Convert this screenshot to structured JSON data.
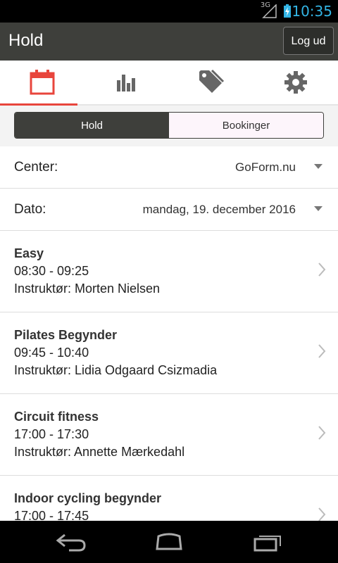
{
  "status": {
    "network": "3G",
    "time": "10:35"
  },
  "appbar": {
    "title": "Hold",
    "logout_label": "Log ud"
  },
  "tabs": [
    {
      "icon": "calendar-icon",
      "active": true
    },
    {
      "icon": "bar-chart-icon",
      "active": false
    },
    {
      "icon": "tag-icon",
      "active": false
    },
    {
      "icon": "gear-icon",
      "active": false
    }
  ],
  "segment": {
    "left": "Hold",
    "right": "Bookinger",
    "selected": "Hold"
  },
  "filters": {
    "center": {
      "label": "Center:",
      "value": "GoForm.nu"
    },
    "date": {
      "label": "Dato:",
      "value": "mandag, 19. december 2016"
    }
  },
  "classes": [
    {
      "name": "Easy",
      "time": "08:30 - 09:25",
      "instructor": "Instruktør: Morten Nielsen"
    },
    {
      "name": "Pilates Begynder",
      "time": "09:45 - 10:40",
      "instructor": "Instruktør: Lidia Odgaard Csizmadia"
    },
    {
      "name": "Circuit fitness",
      "time": "17:00 - 17:30",
      "instructor": "Instruktør: Annette Mærkedahl"
    },
    {
      "name": "Indoor cycling begynder",
      "time": "17:00 - 17:45",
      "instructor": ""
    }
  ],
  "colors": {
    "accent": "#e8453c",
    "actionbar": "#3e3f3b",
    "statusText": "#33b5e5"
  }
}
